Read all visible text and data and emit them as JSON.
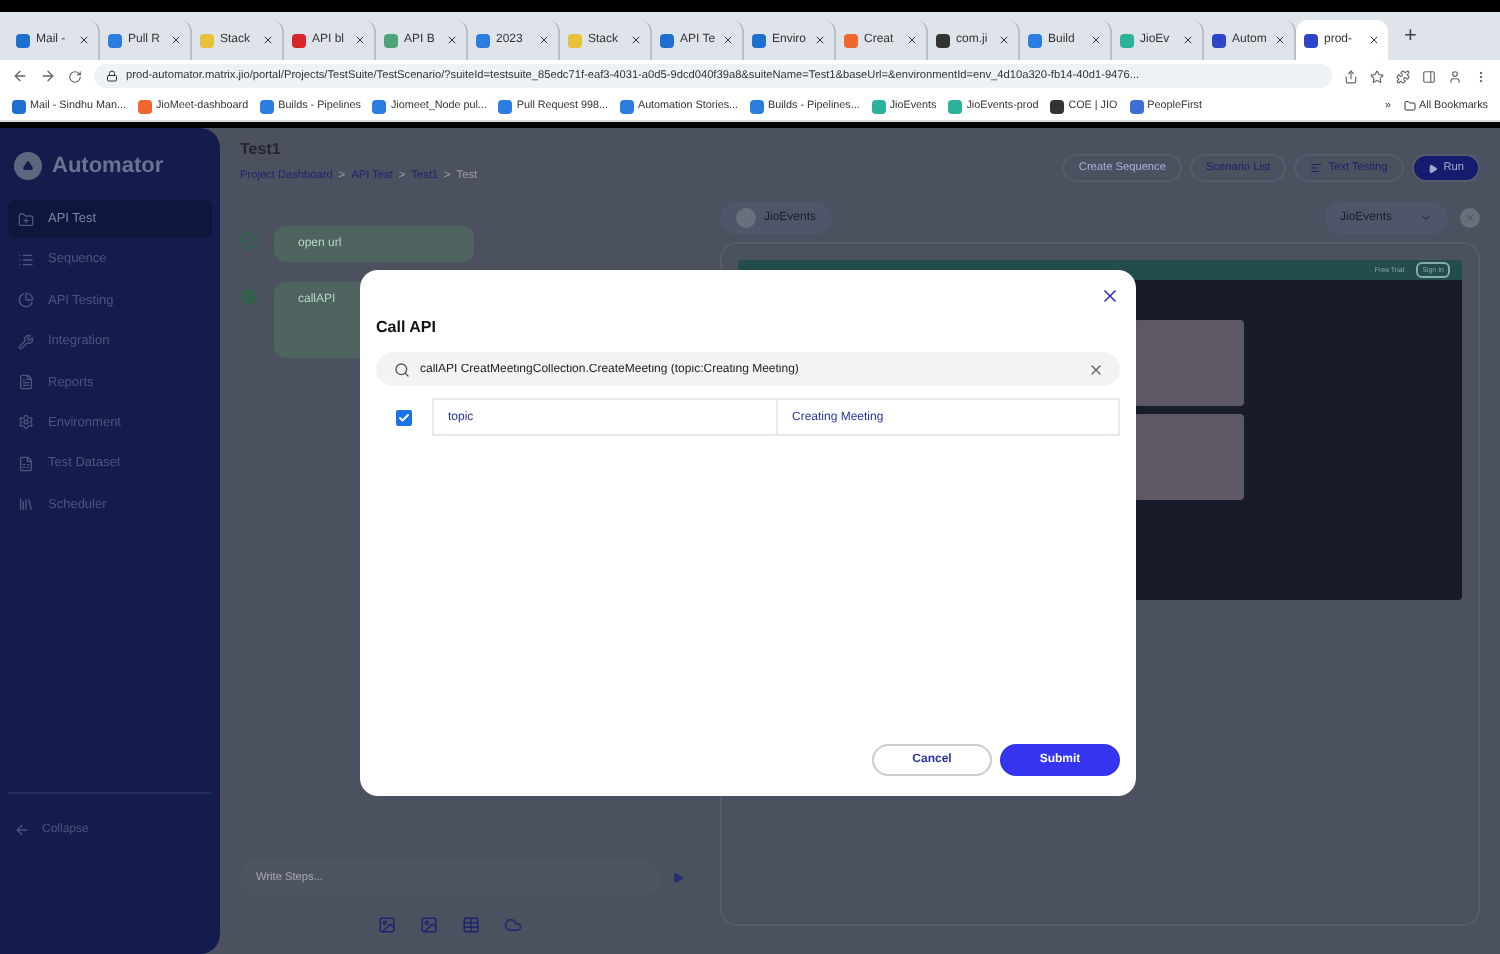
{
  "browser": {
    "tabs": [
      {
        "title": "Mail -",
        "color": "#1f6fd1",
        "selected": false
      },
      {
        "title": "Pull R",
        "color": "#2b7de0",
        "selected": false
      },
      {
        "title": "Stack",
        "color": "#e8c23a",
        "selected": false
      },
      {
        "title": "API bl",
        "color": "#d9262b",
        "selected": false
      },
      {
        "title": "API B",
        "color": "#4ea37a",
        "selected": false
      },
      {
        "title": "2023",
        "color": "#2b7de0",
        "selected": false
      },
      {
        "title": "Stack",
        "color": "#e8c23a",
        "selected": false
      },
      {
        "title": "API Te",
        "color": "#1f6fd1",
        "selected": false
      },
      {
        "title": "Enviro",
        "color": "#1f6fd1",
        "selected": false
      },
      {
        "title": "Creat",
        "color": "#f0662e",
        "selected": false
      },
      {
        "title": "com.ji",
        "color": "#333333",
        "selected": false
      },
      {
        "title": "Build",
        "color": "#2b7de0",
        "selected": false
      },
      {
        "title": "JioEv",
        "color": "#2bb39a",
        "selected": false
      },
      {
        "title": "Autom",
        "color": "#2f45c8",
        "selected": false
      },
      {
        "title": "prod-",
        "color": "#2f45c8",
        "selected": true
      }
    ],
    "new_tab": "+",
    "url": "prod-automator.matrix.jio/portal/Projects/TestSuite/TestScenario/?suiteId=testsuite_85edc71f-eaf3-4031-a0d5-9dcd040f39a8&suiteName=Test1&baseUrl=&environmentId=env_4d10a320-fb14-40d1-9476...",
    "bookmarks": [
      {
        "title": "Mail - Sindhu Man...",
        "color": "#1f6fd1"
      },
      {
        "title": "JioMeet-dashboard",
        "color": "#f0662e"
      },
      {
        "title": "Builds - Pipelines",
        "color": "#2b7de0"
      },
      {
        "title": "Jiomeet_Node pul...",
        "color": "#2b7de0"
      },
      {
        "title": "Pull Request 998...",
        "color": "#2b7de0"
      },
      {
        "title": "Automation Stories...",
        "color": "#2b7de0"
      },
      {
        "title": "Builds - Pipelines...",
        "color": "#2b7de0"
      },
      {
        "title": "JioEvents",
        "color": "#2bb39a"
      },
      {
        "title": "JioEvents-prod",
        "color": "#2bb39a"
      },
      {
        "title": "COE | JIO",
        "color": "#333333"
      },
      {
        "title": "PeopleFirst",
        "color": "#3b6fd6"
      }
    ],
    "more_bookmarks": "»",
    "all_bookmarks": "All Bookmarks"
  },
  "sidebar": {
    "brand": "Automator",
    "items": [
      {
        "label": "API Test",
        "selected": true
      },
      {
        "label": "Sequence",
        "selected": false
      },
      {
        "label": "API Testing",
        "selected": false
      },
      {
        "label": "Integration",
        "selected": false
      },
      {
        "label": "Reports",
        "selected": false
      },
      {
        "label": "Environment",
        "selected": false
      },
      {
        "label": "Test Dataset",
        "selected": false
      },
      {
        "label": "Scheduler",
        "selected": false
      }
    ],
    "collapse": "Collapse"
  },
  "header": {
    "title": "Test1",
    "breadcrumb": [
      "Project Dashboard",
      "API Test",
      "Test1",
      "Test"
    ],
    "separator": ">",
    "buttons": [
      {
        "label": "Create Sequence",
        "kind": "ghost"
      },
      {
        "label": "Scenario List",
        "kind": "outline"
      },
      {
        "label": "Text Testing",
        "kind": "icon"
      },
      {
        "label": "Run",
        "kind": "primary"
      }
    ]
  },
  "steps": [
    {
      "text": "open url",
      "kind": "done"
    },
    {
      "text": "callAPI",
      "kind": "running"
    }
  ],
  "step_input": {
    "placeholder": "Write Steps..."
  },
  "preview": {
    "site": "JioEvents",
    "environment": "JioEvents",
    "nav": [
      "Free Trial",
      "Sign In"
    ]
  },
  "dialog": {
    "title": "Call API",
    "search": "callAPI CreatMeetingCollection.CreateMeeting (topic:Creating Meeting)",
    "params": [
      {
        "name": "topic",
        "value": "Creating Meeting",
        "checked": true
      }
    ],
    "buttons": [
      {
        "label": "Cancel",
        "kind": "secondary"
      },
      {
        "label": "Submit",
        "kind": "primary"
      }
    ]
  }
}
